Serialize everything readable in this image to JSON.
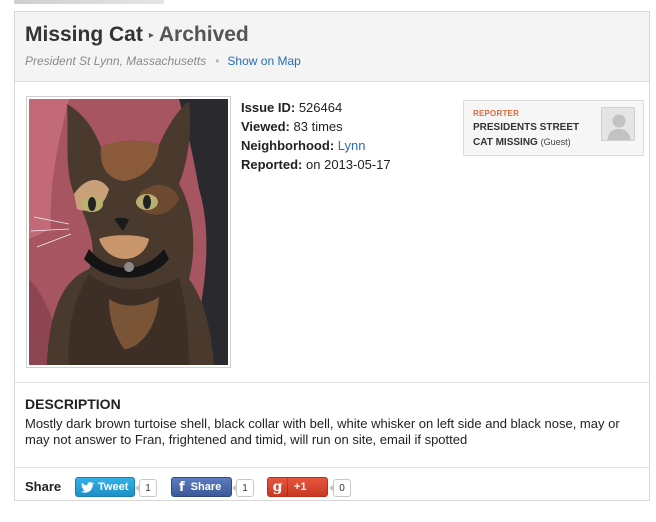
{
  "header": {
    "title": "Missing Cat",
    "separator": "▸",
    "status": "Archived",
    "address": "President St Lynn, Massachusetts",
    "address_dot": "•",
    "map_link": "Show on Map"
  },
  "photo": {
    "subject": "tortoiseshell-cat-photo"
  },
  "info": {
    "issue_id_label": "Issue ID:",
    "issue_id_value": "526464",
    "viewed_label": "Viewed:",
    "viewed_value": "83 times",
    "neighborhood_label": "Neighborhood:",
    "neighborhood_value": "Lynn",
    "reported_label": "Reported:",
    "reported_value": "on 2013-05-17"
  },
  "reporter": {
    "tag": "REPORTER",
    "name": "PRESIDENTS STREET CAT MISSING",
    "role": "(Guest)"
  },
  "description": {
    "title": "DESCRIPTION",
    "text": "Mostly dark brown turtoise shell, black collar with bell, white whisker on left side and black nose, may or may not answer to Fran, frightened and timid, will run on site, email if spotted"
  },
  "share": {
    "label": "Share",
    "twitter_label": "Tweet",
    "twitter_count": "1",
    "facebook_label": "Share",
    "facebook_count": "1",
    "gplus_label": "+1",
    "gplus_count": "0"
  },
  "colors": {
    "link": "#2a6cb0",
    "reporter_tag": "#e06a3c",
    "twitter": "#1d8fc6",
    "facebook": "#3b5998",
    "gplus": "#c73a25"
  }
}
